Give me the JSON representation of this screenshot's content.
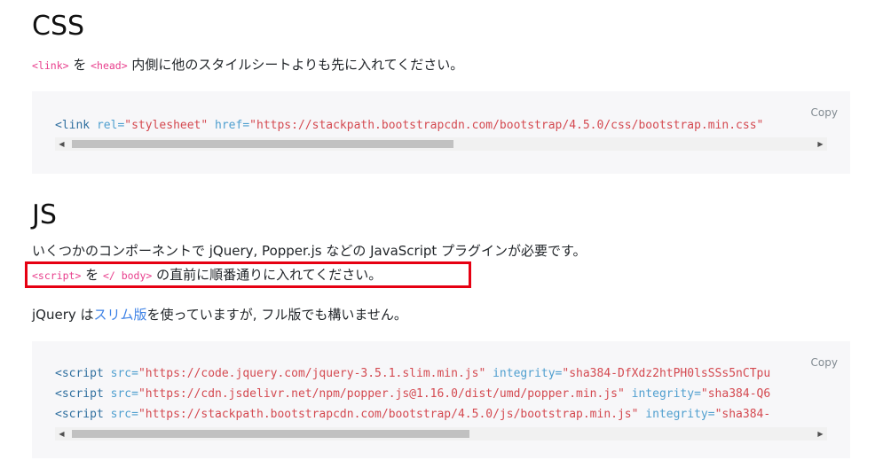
{
  "css_section": {
    "heading": "CSS",
    "desc_code1": "<link>",
    "desc_text1": " を ",
    "desc_code2": "<head>",
    "desc_text2": " 内側に他のスタイルシートよりも先に入れてください。",
    "copy_label": "Copy",
    "code_line": {
      "open": "<link",
      "attr1": " rel=",
      "val1": "\"stylesheet\"",
      "attr2": " href=",
      "val2": "\"https://stackpath.bootstrapcdn.com/bootstrap/4.5.0/css/bootstrap.min.css\""
    }
  },
  "js_section": {
    "heading": "JS",
    "desc_line1": "いくつかのコンポーネントで jQuery, Popper.js などの JavaScript プラグインが必要です。",
    "desc_code1": "<script>",
    "desc_text1": " を ",
    "desc_code2": "</ body>",
    "desc_text2": " の直前に順番通りに入れてください。",
    "note_prefix": "jQuery は",
    "note_link": "スリム版",
    "note_suffix": "を使っていますが, フル版でも構いません。",
    "copy_label": "Copy",
    "code_lines": [
      {
        "open": "<script",
        "attr1": " src=",
        "val1": "\"https://code.jquery.com/jquery-3.5.1.slim.min.js\"",
        "attr2": " integrity=",
        "val2": "\"sha384-DfXdz2htPH0lsSSs5nCTpu"
      },
      {
        "open": "<script",
        "attr1": " src=",
        "val1": "\"https://cdn.jsdelivr.net/npm/popper.js@1.16.0/dist/umd/popper.min.js\"",
        "attr2": " integrity=",
        "val2": "\"sha384-Q6"
      },
      {
        "open": "<script",
        "attr1": " src=",
        "val1": "\"https://stackpath.bootstrapcdn.com/bootstrap/4.5.0/js/bootstrap.min.js\"",
        "attr2": " integrity=",
        "val2": "\"sha384-"
      }
    ]
  },
  "scrollbar": {
    "left_arrow": "◀",
    "right_arrow": "▶"
  },
  "colors": {
    "highlight_border": "#e60012",
    "inline_code": "#e83e8c",
    "link": "#3f83e6",
    "code_bg": "#f7f7f9"
  }
}
